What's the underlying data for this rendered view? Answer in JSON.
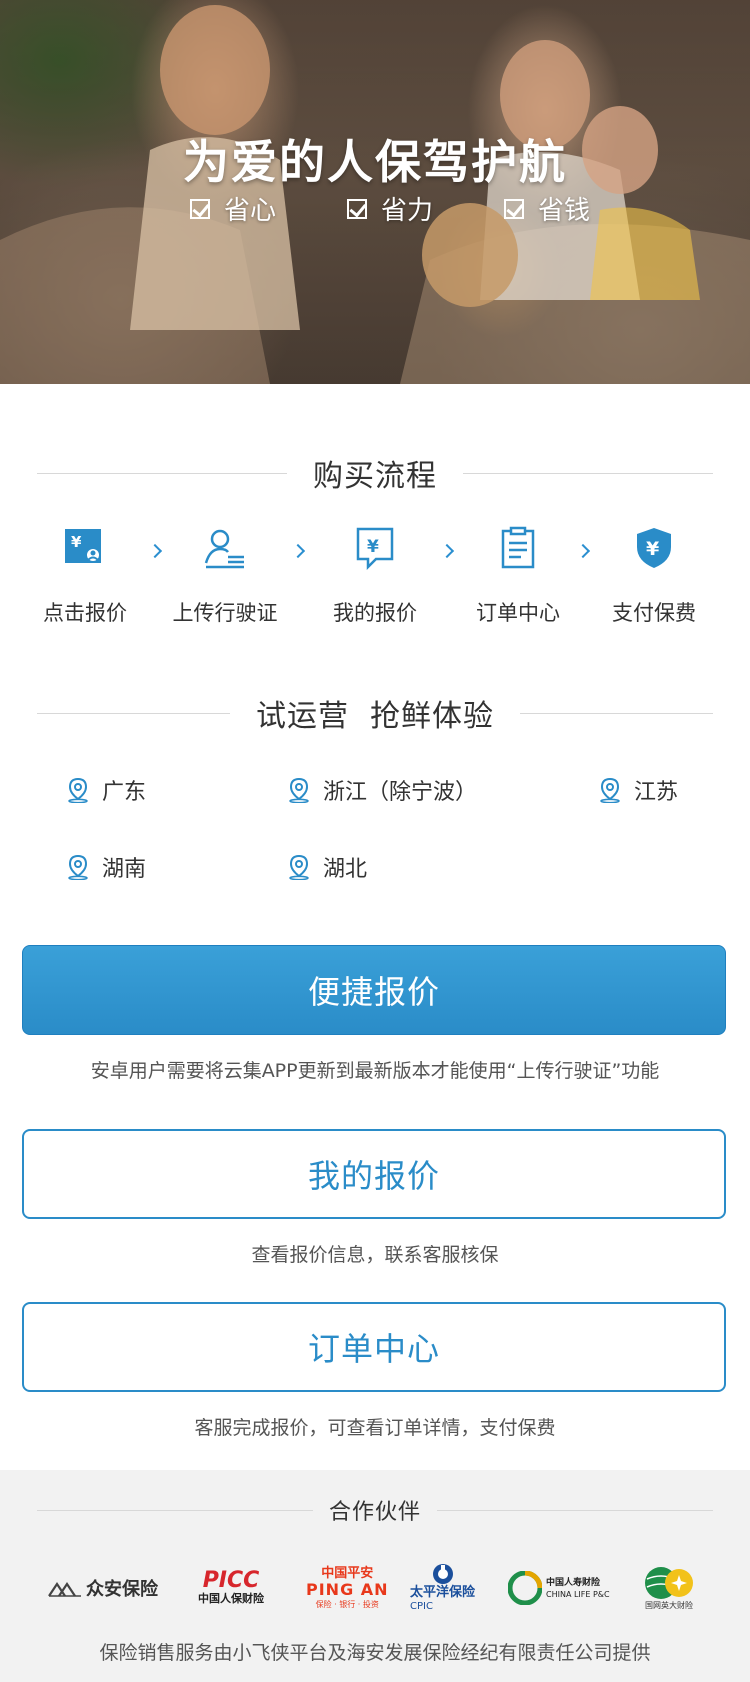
{
  "hero": {
    "title": "为爱的人保驾护航",
    "tags": [
      "省心",
      "省力",
      "省钱"
    ]
  },
  "process": {
    "title": "购买流程",
    "steps": [
      {
        "label": "点击报价",
        "icon": "quote-icon"
      },
      {
        "label": "上传行驶证",
        "icon": "upload-license-icon"
      },
      {
        "label": "我的报价",
        "icon": "my-quote-icon"
      },
      {
        "label": "订单中心",
        "icon": "order-icon"
      },
      {
        "label": "支付保费",
        "icon": "pay-shield-icon"
      }
    ]
  },
  "trial": {
    "title": "试运营  抢鲜体验",
    "regions": [
      "广东",
      "浙江（除宁波）",
      "江苏",
      "湖南",
      "湖北"
    ]
  },
  "actions": {
    "quick_quote": "便捷报价",
    "quick_quote_note": "安卓用户需要将云集APP更新到最新版本才能使用“上传行驶证”功能",
    "my_quote": "我的报价",
    "my_quote_note": "查看报价信息，联系客服核保",
    "order_center": "订单中心",
    "order_center_note": "客服完成报价，可查看订单详情，支付保费"
  },
  "footer": {
    "partners_title": "合作伙伴",
    "partners": [
      {
        "name": "众安保险"
      },
      {
        "name": "PICC",
        "sub": "中国人保财险"
      },
      {
        "name": "中国平安",
        "sub": "PING AN",
        "sub2": "保险 · 银行 · 投资"
      },
      {
        "name": "太平洋保险",
        "sub": "CPIC"
      },
      {
        "name": "中国人寿财险",
        "sub": "CHINA LIFE P&C"
      },
      {
        "name": "国网英大财险"
      }
    ],
    "disclaimer": "保险销售服务由小飞侠平台及海安发展保险经纪有限责任公司提供"
  },
  "colors": {
    "accent": "#2a8cc8",
    "picc_red": "#d7262c",
    "pingan_red": "#e8381b",
    "cpic_blue": "#1b4f9c",
    "chinalife_green": "#1f8f4a"
  }
}
